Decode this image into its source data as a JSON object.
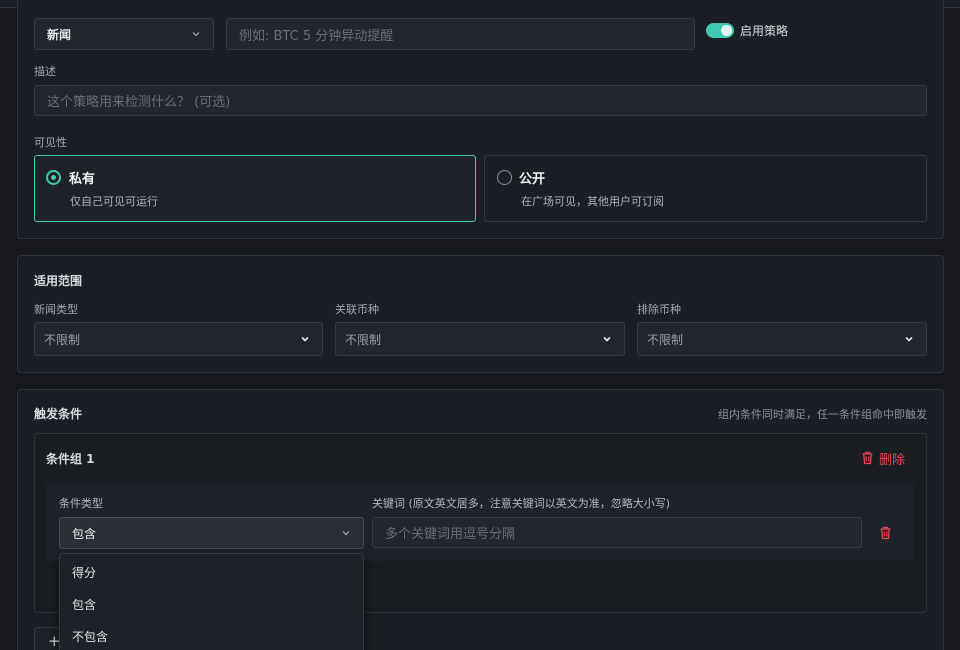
{
  "basic": {
    "category_value": "新闻",
    "name_placeholder": "例如: BTC 5 分钟异动提醒",
    "enable_label": "启用策略",
    "enabled": true,
    "desc_label": "描述",
    "desc_placeholder": "这个策略用来检测什么？ (可选)",
    "visibility_label": "可见性",
    "private": {
      "title": "私有",
      "desc": "仅自己可见可运行",
      "selected": true
    },
    "public": {
      "title": "公开",
      "desc": "在广场可见，其他用户可订阅",
      "selected": false
    }
  },
  "scope": {
    "title": "适用范围",
    "fields": [
      {
        "label": "新闻类型",
        "value": "不限制"
      },
      {
        "label": "关联币种",
        "value": "不限制"
      },
      {
        "label": "排除币种",
        "value": "不限制"
      }
    ]
  },
  "trigger": {
    "title": "触发条件",
    "hint": "组内条件同时满足，任一条件组命中即触发",
    "group": {
      "title": "条件组 1",
      "delete_label": "删除",
      "type_label": "条件类型",
      "type_value": "包含",
      "keyword_label": "关键词 (原文英文居多，注意关键词以英文为准，忽略大小写)",
      "keyword_placeholder": "多个关键词用逗号分隔"
    },
    "dropdown_options": [
      "得分",
      "包含",
      "不包含"
    ],
    "add_glyph": "+"
  },
  "colors": {
    "accent": "#3ec9b0",
    "danger": "#e5484d"
  },
  "icons": {
    "chevron": "chevron-down-icon",
    "trash": "trash-icon",
    "plus": "plus-icon"
  }
}
